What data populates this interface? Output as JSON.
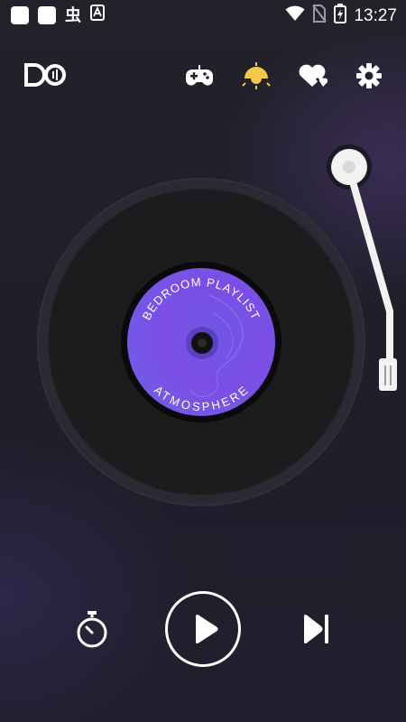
{
  "status_bar": {
    "time": "13:27",
    "left_glyph": "虫",
    "icons": [
      "notification-square-icon",
      "notification-square-icon",
      "app-glyph-icon",
      "a-box-icon",
      "wifi-icon",
      "no-sim-icon",
      "battery-charging-icon"
    ]
  },
  "header": {
    "logo": "DO",
    "icons": [
      "gamepad-icon",
      "lamp-icon",
      "heart-list-icon",
      "gear-icon"
    ],
    "colors": {
      "lamp_active": "#f5c84b",
      "icon": "#ffffff"
    }
  },
  "record": {
    "label_top": "BEDROOM PLAYLIST",
    "label_bottom": "ATMOSPHERE",
    "colors": {
      "label": "#7b4ee6",
      "vinyl": "#1c1c1e"
    }
  },
  "controls": {
    "icons": [
      "timer-icon",
      "play-icon",
      "skip-next-icon"
    ]
  }
}
